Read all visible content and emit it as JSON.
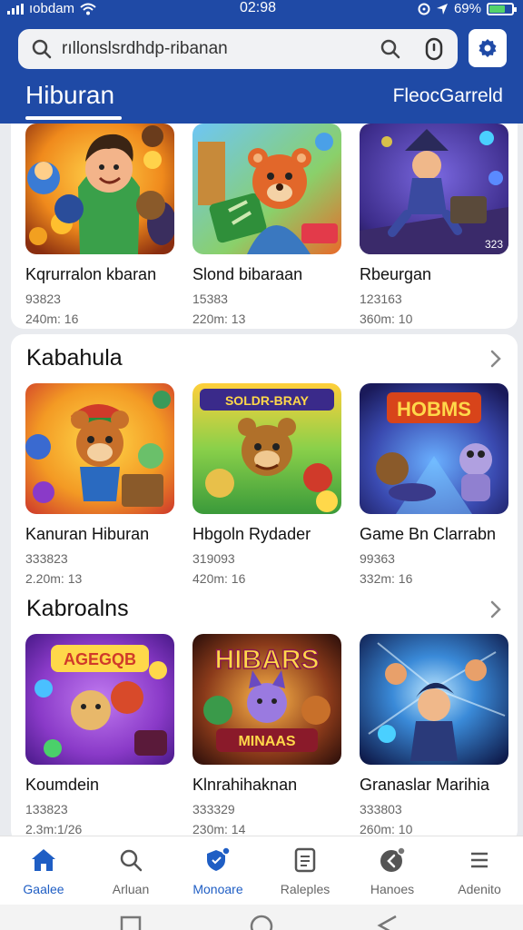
{
  "status": {
    "carrier": "ıobdam",
    "time": "02:98",
    "battery": "69%",
    "battery_level": 0.69
  },
  "search": {
    "value": "rıllonslsrdhdp-ribanan"
  },
  "header": {
    "active_tab": "Hiburan",
    "right_tab": "FleocGarreld"
  },
  "top_row": [
    {
      "name": "Kqrurralon kbaran",
      "meta1": "93823",
      "meta2": "240m: 16",
      "badge": ""
    },
    {
      "name": "Slond bibaraan",
      "meta1": "15383",
      "meta2": "220m: 13",
      "badge": ""
    },
    {
      "name": "Rbeurgan",
      "meta1": "123163",
      "meta2": "360m: 10",
      "badge": "323"
    }
  ],
  "section2": {
    "title": "Kabahula",
    "items": [
      {
        "name": "Kanuran Hiburan",
        "meta1": "333823",
        "meta2": "2.20m: 13",
        "art_text": ""
      },
      {
        "name": "Hbgoln Rydader",
        "meta1": "319093",
        "meta2": "420m: 16",
        "art_text": "SOLDR-BRAY"
      },
      {
        "name": "Game Bn Clarrabn",
        "meta1": "99363",
        "meta2": "332m: 16",
        "art_text": "HOBMS"
      }
    ]
  },
  "section3": {
    "title": "Kabroalns",
    "items": [
      {
        "name": "Koumdein",
        "meta1": "133823",
        "meta2": "2.3m:1/26",
        "art_text": "AGEGQB"
      },
      {
        "name": "Klnrahihaknan",
        "meta1": "333329",
        "meta2": "230m: 14",
        "art_text": "HIBARS",
        "art_text2": "MINAAS"
      },
      {
        "name": "Granaslar Marihia",
        "meta1": "333803",
        "meta2": "260m: 10",
        "art_text": ""
      }
    ]
  },
  "bottom_nav": [
    {
      "label": "Gaalee",
      "icon": "home-icon"
    },
    {
      "label": "Arluan",
      "icon": "search-icon"
    },
    {
      "label": "Monoare",
      "icon": "shield-icon"
    },
    {
      "label": "Raleples",
      "icon": "document-icon"
    },
    {
      "label": "Hanoes",
      "icon": "back-badge-icon"
    },
    {
      "label": "Adenito",
      "icon": "menu-icon"
    }
  ],
  "colors": {
    "header": "#1f4aa6",
    "active": "#1f5ec4",
    "background": "#e9ebef"
  }
}
